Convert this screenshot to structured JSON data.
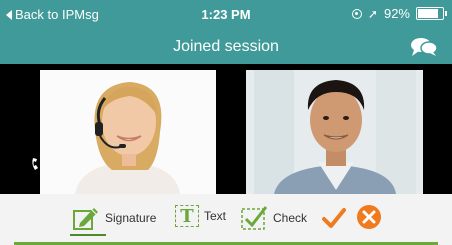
{
  "status_bar": {
    "back_label": "Back to IPMsg",
    "time": "1:23 PM",
    "battery": "92%",
    "battery_level": 0.92
  },
  "nav": {
    "title": "Joined session",
    "chat_icon": "chat-bubbles-icon"
  },
  "videos": {
    "left": "participant-video-woman",
    "right": "participant-video-man"
  },
  "toolbar": {
    "signature_label": "Signature",
    "text_label": "Text",
    "text_icon_letter": "T",
    "check_label": "Check",
    "accent_color": "#6ca83a",
    "confirm_color": "#f07a1e"
  }
}
